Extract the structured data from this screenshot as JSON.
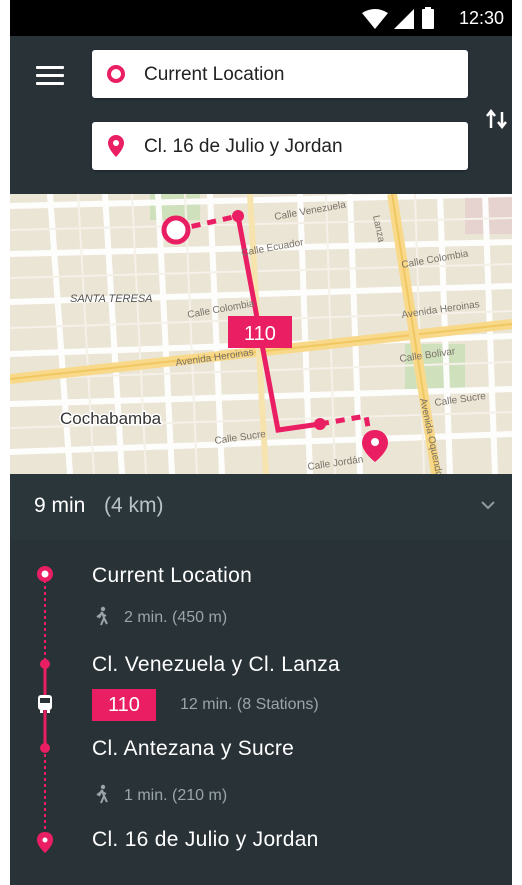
{
  "status_bar": {
    "time": "12:30"
  },
  "search": {
    "origin": "Current Location",
    "destination": "Cl. 16 de Julio y Jordan",
    "separator": ":"
  },
  "map": {
    "city_label": "Cochabamba",
    "district_label": "SANTA TERESA",
    "route_badge": "110",
    "street_labels": {
      "venezuela": "Calle Venezuela",
      "ecuador": "Calle Ecuador",
      "colombia_left": "Calle Colombia",
      "colombia_right": "Calle Colombia",
      "heroinas_left": "Avenida Heroinas",
      "heroinas_right": "Avenida Heroinas",
      "bolivar": "Calle Bolivar",
      "sucre_left": "Calle Sucre",
      "sucre_right": "Calle Sucre",
      "jordan": "Calle Jordán",
      "oquendo": "Avenida Oquendo",
      "lanza": "Lanza"
    }
  },
  "summary": {
    "duration": "9 min",
    "distance": "(4 km)"
  },
  "steps": {
    "origin": "Current Location",
    "walk1": "2 min. (450 m)",
    "stop1": "Cl. Venezuela y Cl. Lanza",
    "bus_route": "110",
    "bus_info": "12 min. (8 Stations)",
    "stop2": "Cl. Antezana y Sucre",
    "walk2": "1 min. (210 m)",
    "destination": "Cl. 16 de Julio y Jordan"
  },
  "colors": {
    "accent": "#e91e63",
    "toolbar": "#283237",
    "summary_bg": "#2b363b"
  },
  "icons": [
    "menu-icon",
    "origin-ring-icon",
    "destination-pin-icon",
    "swap-icon",
    "chevron-down-icon",
    "walk-icon",
    "bus-icon",
    "wifi-icon",
    "signal-icon",
    "battery-icon"
  ]
}
